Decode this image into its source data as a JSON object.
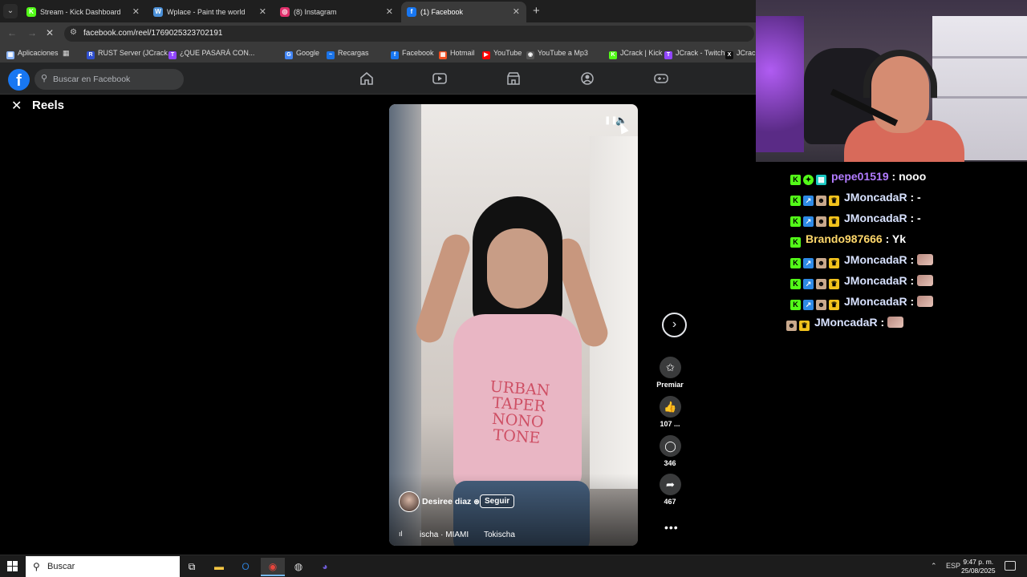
{
  "browser": {
    "tabs": [
      {
        "title": "Stream - Kick Dashboard",
        "favicon": "kick-icon",
        "color": "#53fc18",
        "letter": "K"
      },
      {
        "title": "Wplace - Paint the world",
        "favicon": "globe-icon",
        "color": "#4a90d9",
        "letter": "W"
      },
      {
        "title": "(8) Instagram",
        "favicon": "instagram-icon",
        "color": "#e1306c",
        "letter": "◎"
      },
      {
        "title": "(1) Facebook",
        "favicon": "facebook-icon",
        "color": "#1877f2",
        "letter": "f"
      }
    ],
    "url": "facebook.com/reel/1769025323702191",
    "bookmarks": [
      {
        "label": "Aplicaciones",
        "color": "#8ab4f8",
        "letter": "▦"
      },
      {
        "label": "RUST Server (JCrack...",
        "color": "#2f4fd0",
        "letter": "R"
      },
      {
        "label": "¿QUE PASARÁ CON...",
        "color": "#9146ff",
        "letter": "T"
      },
      {
        "label": "Google",
        "color": "#4285f4",
        "letter": "G"
      },
      {
        "label": "Recargas",
        "color": "#1a73e8",
        "letter": "~"
      },
      {
        "label": "Facebook",
        "color": "#1877f2",
        "letter": "f"
      },
      {
        "label": "Hotmail",
        "color": "#f25022",
        "letter": "▦"
      },
      {
        "label": "YouTube",
        "color": "#ff0000",
        "letter": "▶"
      },
      {
        "label": "YouTube a Mp3",
        "color": "#555",
        "letter": "◉"
      },
      {
        "label": "JCrack | Kick",
        "color": "#53fc18",
        "letter": "K"
      },
      {
        "label": "JCrack - Twitch",
        "color": "#9146ff",
        "letter": "T"
      },
      {
        "label": "JCrack",
        "color": "#111",
        "letter": "X"
      }
    ]
  },
  "facebook": {
    "search_placeholder": "Buscar en Facebook",
    "reels_title": "Reels",
    "author": "Desiree diaz",
    "follow_label": "Seguir",
    "audio_text": "ischa · MIAMI",
    "audio_text2": "Tokischa",
    "shirt_print": "URBAN TAPER NONO TONE",
    "actions": [
      {
        "icon": "star-icon",
        "glyph": "✩",
        "label": "Premiar"
      },
      {
        "icon": "like-icon",
        "glyph": "👍",
        "label": "107 ..."
      },
      {
        "icon": "comment-icon",
        "glyph": "◯",
        "label": "346"
      },
      {
        "icon": "share-icon",
        "glyph": "➦",
        "label": "467"
      }
    ],
    "more": "•••"
  },
  "chat": {
    "messages": [
      {
        "badges": [
          "kick",
          "plus",
          "gem"
        ],
        "user": "pepe01519",
        "user_color": "#b27cff",
        "text": "nooo",
        "emote": false
      },
      {
        "badges": [
          "kick",
          "blue",
          "skull",
          "crown"
        ],
        "user": "JMoncadaR",
        "user_color": "#d8e2ff",
        "text": "-",
        "emote": false
      },
      {
        "badges": [
          "kick",
          "blue",
          "skull",
          "crown"
        ],
        "user": "JMoncadaR",
        "user_color": "#d8e2ff",
        "text": "-",
        "emote": false
      },
      {
        "badges": [
          "kick"
        ],
        "user": "Brando987666",
        "user_color": "#ffd86b",
        "text": "Yk",
        "emote": false
      },
      {
        "badges": [
          "kick",
          "blue",
          "skull",
          "crown"
        ],
        "user": "JMoncadaR",
        "user_color": "#d8e2ff",
        "text": "",
        "emote": true
      },
      {
        "badges": [
          "kick",
          "blue",
          "skull",
          "crown"
        ],
        "user": "JMoncadaR",
        "user_color": "#d8e2ff",
        "text": "",
        "emote": true
      },
      {
        "badges": [
          "kick",
          "blue",
          "skull",
          "crown"
        ],
        "user": "JMoncadaR",
        "user_color": "#d8e2ff",
        "text": "",
        "emote": true
      },
      {
        "badges": [
          "skull",
          "crown"
        ],
        "user": "JMoncadaR",
        "user_color": "#d8e2ff",
        "text": "",
        "emote": true
      }
    ]
  },
  "taskbar": {
    "search_placeholder": "Buscar",
    "lang": "ESP",
    "time": "9:47 p. m.",
    "date": "25/08/2025"
  }
}
